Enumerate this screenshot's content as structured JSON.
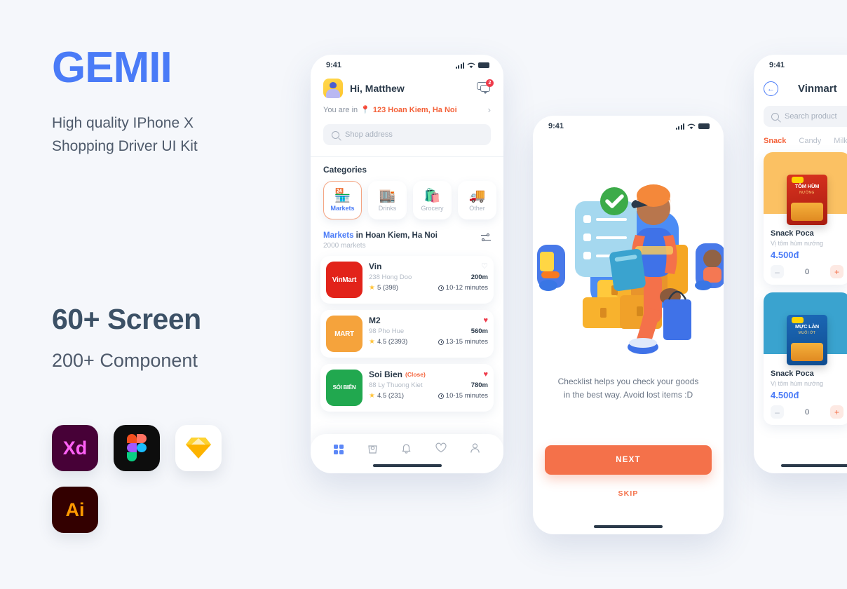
{
  "promo": {
    "brand": "GEMII",
    "tagline_line1": "High quality IPhone X",
    "tagline_line2": "Shopping Driver UI Kit",
    "stat_primary": "60+ Screen",
    "stat_secondary": "200+ Component",
    "app_icons": [
      {
        "name": "adobe-xd-icon",
        "label": "Xd"
      },
      {
        "name": "figma-icon",
        "label": ""
      },
      {
        "name": "sketch-icon",
        "label": ""
      },
      {
        "name": "adobe-illustrator-icon",
        "label": "Ai"
      }
    ]
  },
  "colors": {
    "brand_blue": "#4a7bf7",
    "accent_orange": "#f4714a",
    "location_orange": "#f4623a",
    "heading_slate": "#2b3a4a",
    "page_bg": "#f5f7fb"
  },
  "phone_home": {
    "status_time": "9:41",
    "greeting": "Hi, Matthew",
    "chat_badge": "2",
    "location_prefix": "You are in",
    "location": "123 Hoan Kiem, Ha Noi",
    "search_placeholder": "Shop address",
    "categories_title": "Categories",
    "categories": [
      {
        "label": "Markets",
        "emoji": "🏪",
        "active": true
      },
      {
        "label": "Drinks",
        "emoji": "🏬",
        "active": false
      },
      {
        "label": "Grocery",
        "emoji": "🛍️",
        "active": false
      },
      {
        "label": "Other",
        "emoji": "🚚",
        "active": false
      }
    ],
    "list_title_bold": "Markets",
    "list_title_rest": " in Hoan Kiem, Ha Noi",
    "list_subtitle": "2000 markets",
    "markets": [
      {
        "logo_text": "VinMart",
        "logo_sup": "+",
        "name": "Vin",
        "closed_tag": "",
        "address": "238 Hong Doo",
        "distance": "200m",
        "rating": "5 (398)",
        "time": "10-12 minutes",
        "favorite": false
      },
      {
        "logo_text": "MART",
        "logo_sup": "",
        "name": "M2",
        "closed_tag": "",
        "address": "98 Pho Hue",
        "distance": "560m",
        "rating": "4.5 (2393)",
        "time": "13-15 minutes",
        "favorite": true
      },
      {
        "logo_text": "SÓI BIỂN",
        "logo_sup": "",
        "name": "Soi Bien",
        "closed_tag": "(Close)",
        "address": "88 Ly Thuong Kiet",
        "distance": "780m",
        "rating": "4.5 (231)",
        "time": "10-15 minutes",
        "favorite": true
      }
    ],
    "tabs": [
      {
        "name": "tab-home",
        "icon": "grid-icon",
        "active": true
      },
      {
        "name": "tab-orders",
        "icon": "bag-icon",
        "active": false
      },
      {
        "name": "tab-notifications",
        "icon": "bell-icon",
        "active": false
      },
      {
        "name": "tab-favorites",
        "icon": "heart-icon",
        "active": false
      },
      {
        "name": "tab-profile",
        "icon": "user-icon",
        "active": false
      }
    ]
  },
  "phone_onboard": {
    "status_time": "9:41",
    "illustration": "delivery-man-checklist-illustration",
    "description": "Checklist helps you check your goods in the best way. Avoid lost items :D",
    "dots": [
      false,
      true,
      false
    ],
    "next_label": "NEXT",
    "skip_label": "SKIP"
  },
  "phone_products": {
    "status_time": "9:41",
    "title": "Vinmart",
    "search_placeholder": "Search product",
    "tabs": [
      {
        "label": "Snack",
        "active": true
      },
      {
        "label": "Candy",
        "active": false
      },
      {
        "label": "Milk",
        "active": false
      }
    ],
    "products": [
      {
        "packet_brand": "POCA",
        "packet_title": "TÔM HÙM",
        "packet_sub": "NƯỚNG",
        "name": "Snack Poca",
        "sub": "Vị tôm hùm nướng",
        "price": "4.500đ",
        "qty": "0",
        "minus": "–",
        "plus": "+"
      },
      {
        "packet_brand": "POCA",
        "packet_title": "MỰC LÀN",
        "packet_sub": "MUỐI ỚT",
        "name": "Snack Poca",
        "sub": "Vị tôm hùm nướng",
        "price": "4.500đ",
        "qty": "0",
        "minus": "–",
        "plus": "+"
      }
    ]
  }
}
